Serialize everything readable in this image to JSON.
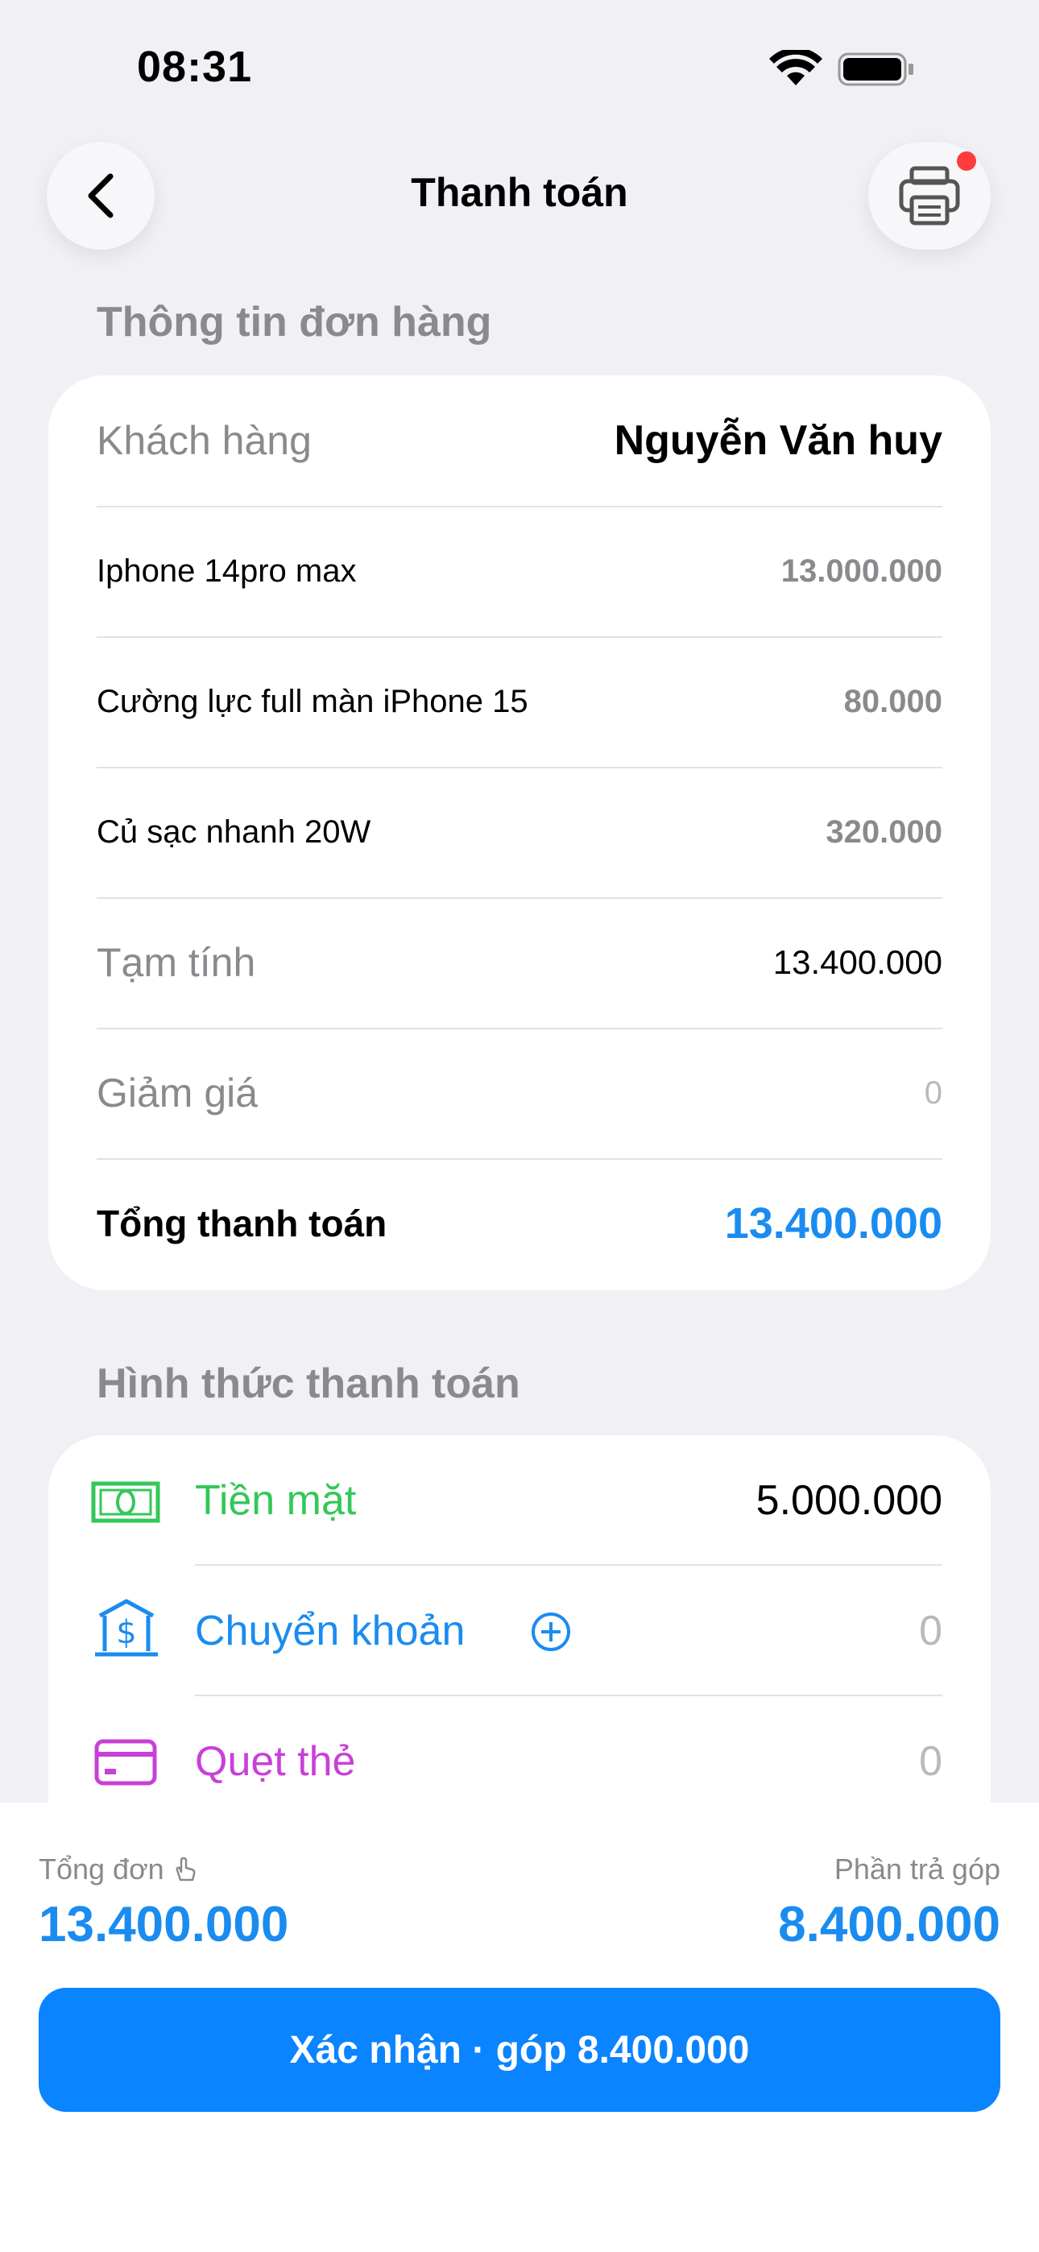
{
  "status_bar": {
    "time": "08:31"
  },
  "header": {
    "title": "Thanh toán"
  },
  "order_section": {
    "title": "Thông tin đơn hàng",
    "customer_label": "Khách hàng",
    "customer_name": "Nguyễn Văn huy",
    "items": [
      {
        "name": "Iphone 14pro max",
        "price": "13.000.000"
      },
      {
        "name": "Cường lực full màn iPhone 15",
        "price": "80.000"
      },
      {
        "name": "Củ sạc nhanh 20W",
        "price": "320.000"
      }
    ],
    "subtotal_label": "Tạm tính",
    "subtotal_value": "13.400.000",
    "discount_label": "Giảm giá",
    "discount_value": "0",
    "total_label": "Tổng thanh toán",
    "total_value": "13.400.000"
  },
  "payment_section": {
    "title": "Hình thức thanh toán",
    "methods": [
      {
        "label": "Tiền mặt",
        "value": "5.000.000",
        "icon": "cash-icon",
        "color": "#34c759"
      },
      {
        "label": "Chuyển khoản",
        "value": "0",
        "icon": "bank-icon",
        "color": "#1a8cf0"
      },
      {
        "label": "Quẹt thẻ",
        "value": "0",
        "icon": "card-icon",
        "color": "#c840d8"
      }
    ]
  },
  "summary": {
    "order_total_label": "Tổng đơn",
    "order_total_value": "13.400.000",
    "installment_label": "Phần trả góp",
    "installment_value": "8.400.000"
  },
  "confirm_button": {
    "label": "Xác nhận · góp 8.400.000"
  },
  "colors": {
    "accent": "#1a8cf0",
    "button": "#0a84ff",
    "notification": "#ff3b3b",
    "background": "#f1f0f5"
  }
}
